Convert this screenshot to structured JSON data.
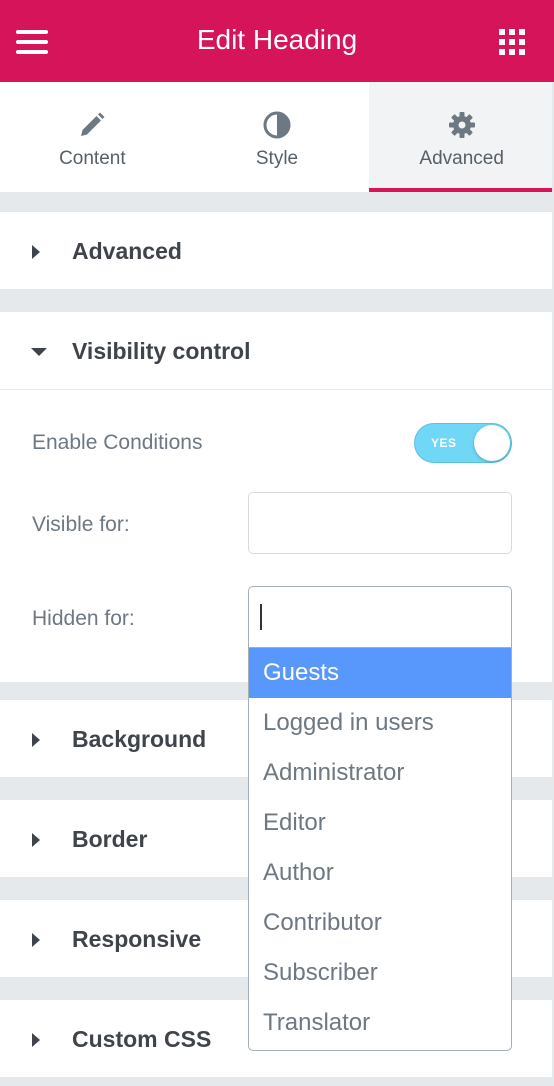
{
  "header": {
    "title": "Edit Heading"
  },
  "tabs": [
    {
      "label": "Content"
    },
    {
      "label": "Style"
    },
    {
      "label": "Advanced"
    }
  ],
  "sections": {
    "advanced": "Advanced",
    "visibility": "Visibility control",
    "background": "Background",
    "border": "Border",
    "responsive": "Responsive",
    "custom_css": "Custom CSS"
  },
  "visibility": {
    "enable_label": "Enable Conditions",
    "toggle_text": "YES",
    "visible_for_label": "Visible for:",
    "visible_for_value": "",
    "hidden_for_label": "Hidden for:",
    "hidden_for_value": ""
  },
  "dropdown": {
    "options": [
      "Guests",
      "Logged in users",
      "Administrator",
      "Editor",
      "Author",
      "Contributor",
      "Subscriber",
      "Translator"
    ],
    "highlighted": "Guests"
  },
  "colors": {
    "brand": "#d5145a",
    "toggle_on": "#71d7f7",
    "highlight": "#5897fb"
  },
  "icons": [
    "menu-icon",
    "apps-grid-icon",
    "pencil-icon",
    "contrast-icon",
    "gear-icon",
    "caret-right-icon",
    "caret-down-icon"
  ]
}
